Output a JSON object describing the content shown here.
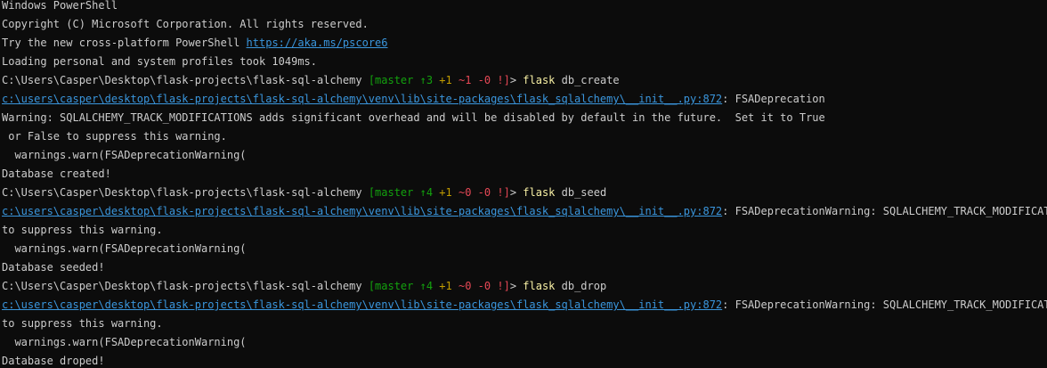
{
  "terminal": {
    "header_title": "Windows PowerShell",
    "copyright": "Copyright (C) Microsoft Corporation. All rights reserved.",
    "try_text": "Try the new cross-platform PowerShell ",
    "try_link": "https://aka.ms/pscore6",
    "profiles": "Loading personal and system profiles took 1049ms.",
    "prompt_path": "C:\\Users\\Casper\\Desktop\\flask-projects\\flask-sql-alchemy ",
    "warn_path": "c:\\users\\casper\\desktop\\flask-projects\\flask-sql-alchemy\\venv\\lib\\site-packages\\flask_sqlalchemy\\__init__.py:872",
    "commands": [
      {
        "branch": "[master ",
        "ahead": "↑3",
        "add": " +1",
        "mod": " ~1",
        "del": " -0",
        "dirty": " !]",
        "prompt_end": "> ",
        "cmd": "flask",
        "args": " db_create",
        "warn_suffix": ": FSADeprecation",
        "msg_lines": [
          "Warning: SQLALCHEMY_TRACK_MODIFICATIONS adds significant overhead and will be disabled by default in the future.  Set it to True",
          " or False to suppress this warning.",
          "  warnings.warn(FSADeprecationWarning(",
          "Database created!"
        ]
      },
      {
        "branch": "[master ",
        "ahead": "↑4",
        "add": " +1",
        "mod": " ~0",
        "del": " -0",
        "dirty": " !]",
        "prompt_end": "> ",
        "cmd": "flask",
        "args": " db_seed",
        "warn_suffix": ": FSADeprecationWarning: SQLALCHEMY_TRACK_MODIFICATIONS",
        "msg_lines": [
          "to suppress this warning.",
          "  warnings.warn(FSADeprecationWarning(",
          "Database seeded!"
        ]
      },
      {
        "branch": "[master ",
        "ahead": "↑4",
        "add": " +1",
        "mod": " ~0",
        "del": " -0",
        "dirty": " !]",
        "prompt_end": "> ",
        "cmd": "flask",
        "args": " db_drop",
        "warn_suffix": ": FSADeprecationWarning: SQLALCHEMY_TRACK_MODIFICATIONS",
        "msg_lines": [
          "to suppress this warning.",
          "  warnings.warn(FSADeprecationWarning(",
          "Database droped!"
        ]
      }
    ]
  }
}
